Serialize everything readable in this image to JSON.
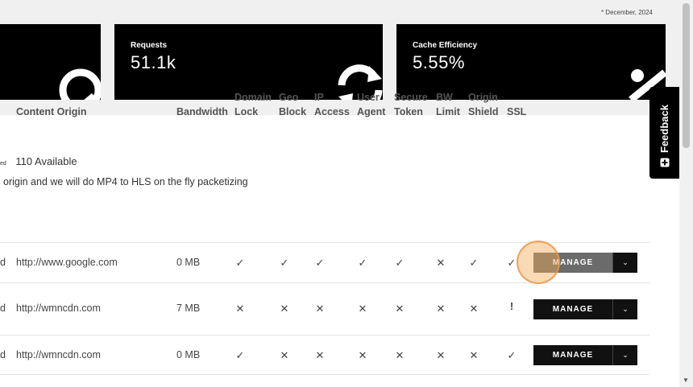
{
  "header": {
    "date_note": "* December, 2024"
  },
  "stats": [
    {
      "label": "",
      "value": ""
    },
    {
      "label": "Requests",
      "value": "51.1k"
    },
    {
      "label": "Cache Efficiency",
      "value": "5.55%"
    }
  ],
  "capacity": {
    "used_label": "ed",
    "available": "110 Available"
  },
  "info_text": "origin and we will do MP4 to HLS on the fly packetizing",
  "columns": {
    "origin": "Content Origin",
    "bandwidth": "Bandwidth",
    "domain_lock": [
      "Domain",
      "Lock"
    ],
    "geo_block": [
      "Geo",
      "Block"
    ],
    "ip_access": [
      "IP",
      "Access"
    ],
    "user_agent": [
      "User",
      "Agent"
    ],
    "secure_token": [
      "Secure",
      "Token"
    ],
    "bw_limit": [
      "BW",
      "Limit"
    ],
    "origin_shield": [
      "Origin",
      "Shield"
    ],
    "ssl": "SSL"
  },
  "rows": [
    {
      "prefix": "d",
      "origin": "http://www.google.com",
      "bandwidth": "0 MB",
      "flags": [
        "✓",
        "✓",
        "✓",
        "✓",
        "✓",
        "✕",
        "✓",
        "✓"
      ],
      "manage": "MANAGE",
      "caret": "⌄"
    },
    {
      "prefix": "d",
      "origin": "http://wmncdn.com",
      "bandwidth": "7 MB",
      "flags": [
        "✕",
        "✕",
        "✕",
        "✕",
        "✕",
        "✕",
        "✕",
        "!"
      ],
      "manage": "MANAGE",
      "caret": "⌄"
    },
    {
      "prefix": "d",
      "origin": "http://wmncdn.com",
      "bandwidth": "0 MB",
      "flags": [
        "✓",
        "✕",
        "✕",
        "✕",
        "✕",
        "✕",
        "✕",
        "✓"
      ],
      "manage": "MANAGE",
      "caret": "⌄"
    }
  ],
  "feedback": {
    "label": "Feedback"
  },
  "colors": {
    "card_bg": "#000000",
    "button_bg": "#111111",
    "focus": "#f0a050"
  }
}
